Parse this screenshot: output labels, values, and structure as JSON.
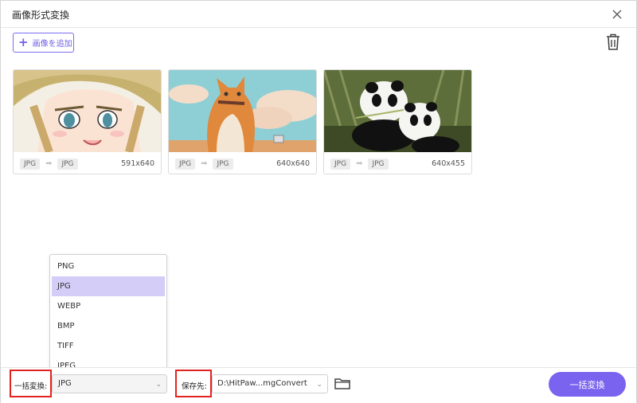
{
  "window": {
    "title": "画像形式変換"
  },
  "toolbar": {
    "add_label": "画像を追加"
  },
  "images": [
    {
      "from": "JPG",
      "to": "JPG",
      "dims": "591x640"
    },
    {
      "from": "JPG",
      "to": "JPG",
      "dims": "640x640"
    },
    {
      "from": "JPG",
      "to": "JPG",
      "dims": "640x455"
    }
  ],
  "format_dropdown": {
    "options": [
      "PNG",
      "JPG",
      "WEBP",
      "BMP",
      "TIFF",
      "JPEG"
    ],
    "selected": "JPG"
  },
  "bottom": {
    "batch_label": "一括変換:",
    "selected_format": "JPG",
    "save_label": "保存先:",
    "save_path": "D:\\HitPaw...mgConvert",
    "convert_label": "一括変換"
  },
  "colors": {
    "accent": "#7a63ee",
    "highlight": "#e1241f",
    "selected_option": "#d3cdf8"
  }
}
